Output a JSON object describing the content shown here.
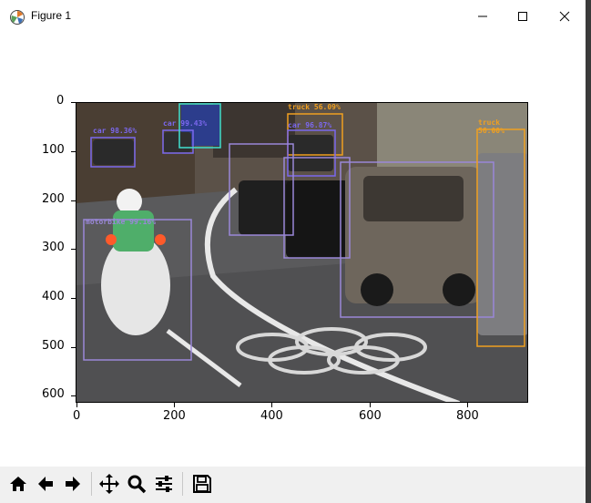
{
  "window": {
    "title": "Figure 1",
    "controls": {
      "minimize_icon": "minimize-icon",
      "maximize_icon": "maximize-icon",
      "close_icon": "close-icon"
    }
  },
  "plot": {
    "x_ticks": [
      "0",
      "200",
      "400",
      "600",
      "800"
    ],
    "y_ticks": [
      "0",
      "100",
      "200",
      "300",
      "400",
      "500",
      "600"
    ],
    "detections": [
      {
        "label": "car 98.36%",
        "color": "#7b68ee"
      },
      {
        "label": "car 99.43%",
        "color": "#7b68ee"
      },
      {
        "label": "truck 56.09%",
        "color": "#f0a020"
      },
      {
        "label": "car 96.87%",
        "color": "#7b68ee"
      },
      {
        "label": "truck 56.00%",
        "color": "#f0a020"
      },
      {
        "label": "motorbike 99.16%",
        "color": "#9a87d8"
      }
    ]
  },
  "toolbar": {
    "buttons": [
      {
        "name": "home-button",
        "icon": "home-icon"
      },
      {
        "name": "back-button",
        "icon": "arrow-left-icon"
      },
      {
        "name": "forward-button",
        "icon": "arrow-right-icon"
      },
      {
        "name": "pan-button",
        "icon": "move-icon"
      },
      {
        "name": "zoom-button",
        "icon": "magnifier-icon"
      },
      {
        "name": "configure-button",
        "icon": "sliders-icon"
      },
      {
        "name": "save-button",
        "icon": "floppy-icon"
      }
    ]
  }
}
